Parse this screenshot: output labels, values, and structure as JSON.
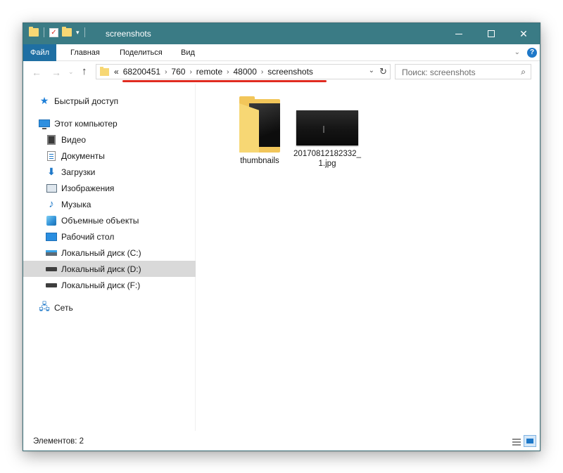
{
  "window": {
    "title": "screenshots",
    "controls": {
      "minimize": "minimize",
      "maximize": "maximize",
      "close": "✕"
    }
  },
  "ribbon": {
    "tabs": [
      "Файл",
      "Главная",
      "Поделиться",
      "Вид"
    ]
  },
  "address": {
    "prefix": "«",
    "crumbs": [
      "68200451",
      "760",
      "remote",
      "48000",
      "screenshots"
    ],
    "search_placeholder": "Поиск: screenshots"
  },
  "nav": {
    "quick_access": "Быстрый доступ",
    "this_pc": "Этот компьютер",
    "items": [
      {
        "label": "Видео",
        "icon": "video-folder-icon"
      },
      {
        "label": "Документы",
        "icon": "documents-folder-icon"
      },
      {
        "label": "Загрузки",
        "icon": "downloads-arrow-icon"
      },
      {
        "label": "Изображения",
        "icon": "pictures-folder-icon"
      },
      {
        "label": "Музыка",
        "icon": "music-note-icon"
      },
      {
        "label": "Объемные объекты",
        "icon": "3d-objects-icon"
      },
      {
        "label": "Рабочий стол",
        "icon": "desktop-icon"
      },
      {
        "label": "Локальный диск (C:)",
        "icon": "system-drive-icon"
      },
      {
        "label": "Локальный диск (D:)",
        "icon": "drive-icon",
        "selected": true
      },
      {
        "label": "Локальный диск (F:)",
        "icon": "drive-icon"
      }
    ],
    "network": "Сеть"
  },
  "content": {
    "files": [
      {
        "name": "thumbnails",
        "type": "folder"
      },
      {
        "name": "20170812182332_1.jpg",
        "line1": "20170812182332_",
        "line2": "1.jpg",
        "type": "image"
      }
    ]
  },
  "status": {
    "count_text": "Элементов: 2"
  },
  "colors": {
    "titlebar": "#3a7b85",
    "file_tab": "#1f6fa3",
    "selected_item": "#d9d9d9",
    "annotation_underline": "#e02b20"
  }
}
